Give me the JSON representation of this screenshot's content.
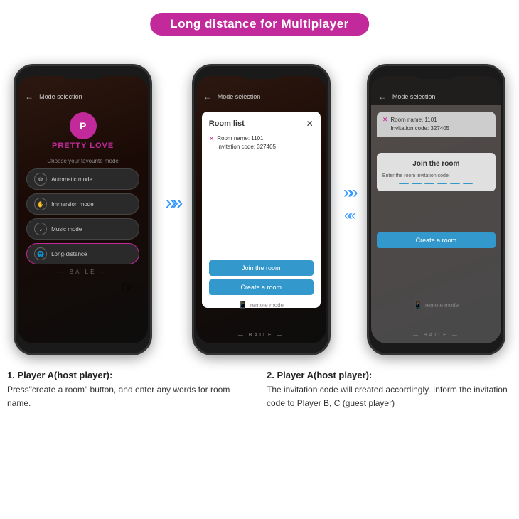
{
  "title": {
    "text": "Long distance for Multiplayer"
  },
  "phone1": {
    "top_bar": {
      "back": "←",
      "mode_label": "Mode selection"
    },
    "logo_letter": "P",
    "logo_text": "PRETTY LOVE",
    "choose_text": "Choose your favourite mode",
    "modes": [
      {
        "icon": "⚙",
        "label": "Automatic mode",
        "active": false
      },
      {
        "icon": "✋",
        "label": "Immersion mode",
        "active": false
      },
      {
        "icon": "♪",
        "label": "Music mode",
        "active": false
      },
      {
        "icon": "🌐",
        "label": "Long-distance",
        "active": true
      }
    ],
    "footer": "— BAILE —"
  },
  "phone2": {
    "top_bar": {
      "back": "←",
      "mode_label": "Mode selection"
    },
    "modal": {
      "title": "Room list",
      "close": "✕",
      "room_name_label": "Room name: 1101",
      "invitation_code_label": "Invitation code: 327405"
    },
    "btn_join": "Join the room",
    "btn_create": "Create a room",
    "remote_label": "remote mode",
    "footer": "— BAILE —"
  },
  "phone3": {
    "top_bar": {
      "back": "←",
      "mode_label": "Mode selection"
    },
    "modal_top": {
      "room_name_label": "Room name: 1101",
      "invitation_code_label": "Invitation code: 327405"
    },
    "join_room_title": "Join the room",
    "invitation_input_label": "Enter the room invitation code:",
    "btn_create": "Create a room",
    "remote_label": "remote mode",
    "footer": "— BAILE —"
  },
  "desc1": {
    "number": "1. Player A(host player):",
    "text": "Press\"create a room\" button, and enter any words for room name."
  },
  "desc2": {
    "number": "2. Player A(host player):",
    "text": "The invitation code will created accordingly. Inform the invitation code to Player B, C (guest player)"
  }
}
